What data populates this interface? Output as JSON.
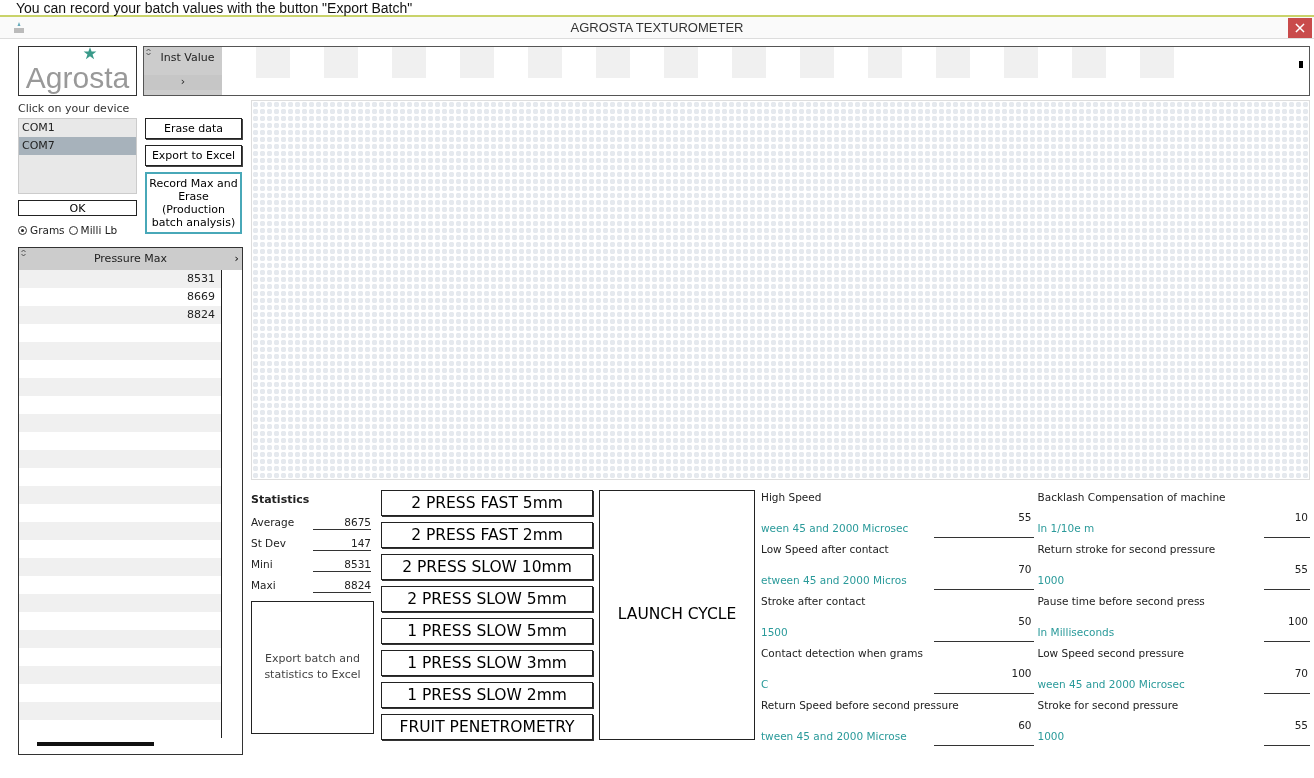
{
  "caption": "You can record your batch values with the button \"Export Batch\"",
  "window": {
    "title": "AGROSTA TEXTUROMETER",
    "close": "×"
  },
  "logo": {
    "text": "Agrosta"
  },
  "inst_value": {
    "header": "Inst Value",
    "expand": "›"
  },
  "device": {
    "prompt": "Click on your device",
    "ports": [
      {
        "label": "COM1",
        "selected": false
      },
      {
        "label": "COM7",
        "selected": true
      }
    ],
    "ok_button": "OK"
  },
  "units": [
    {
      "label": "Grams",
      "selected": true
    },
    {
      "label": "Milli Lb",
      "selected": false
    }
  ],
  "actions": [
    {
      "label": "Erase data",
      "highlighted": false
    },
    {
      "label": "Export to Excel",
      "highlighted": false
    },
    {
      "label": "Record Max and Erase (Production batch analysis)",
      "highlighted": true
    }
  ],
  "pressure_table": {
    "column": "Pressure Max",
    "expand": "›",
    "rows": [
      "8531",
      "8669",
      "8824"
    ]
  },
  "statistics": {
    "title": "Statistics",
    "items": [
      {
        "label": "Average",
        "value": "8675"
      },
      {
        "label": "St Dev",
        "value": "147"
      },
      {
        "label": "Mini",
        "value": "8531"
      },
      {
        "label": "Maxi",
        "value": "8824"
      }
    ],
    "export_button": "Export batch and statistics to Excel"
  },
  "programs": [
    "2 PRESS FAST 5mm",
    "2 PRESS FAST 2mm",
    "2 PRESS SLOW 10mm",
    "2 PRESS SLOW 5mm",
    "1 PRESS SLOW 5mm",
    "1 PRESS SLOW 3mm",
    "1 PRESS SLOW 2mm",
    "FRUIT PENETROMETRY"
  ],
  "launch_button": "LAUNCH CYCLE",
  "parameter_columns": [
    [
      {
        "label": "High Speed",
        "hint": "ween 45 and 2000 Microsec",
        "value": "55"
      },
      {
        "label": "Low Speed after contact",
        "hint": "etween 45 and 2000 Micros",
        "value": "70"
      },
      {
        "label": "Stroke after contact",
        "hint": "1500",
        "value": "50"
      },
      {
        "label": "Contact detection when grams",
        "hint": "C",
        "value": "100"
      },
      {
        "label": "Return Speed before second pressure",
        "hint": "tween 45 and 2000 Microse",
        "value": "60"
      }
    ],
    [
      {
        "label": "Backlash Compensation of machine",
        "hint": "In 1/10e m",
        "value": "10"
      },
      {
        "label": "Return stroke for second pressure",
        "hint": "1000",
        "value": "55"
      },
      {
        "label": "Pause time before second press",
        "hint": "In Milliseconds",
        "value": "100"
      },
      {
        "label": "Low Speed second pressure",
        "hint": "ween 45 and 2000 Microsec",
        "value": "70"
      },
      {
        "label": "Stroke for second pressure",
        "hint": "1000",
        "value": "55"
      }
    ]
  ]
}
